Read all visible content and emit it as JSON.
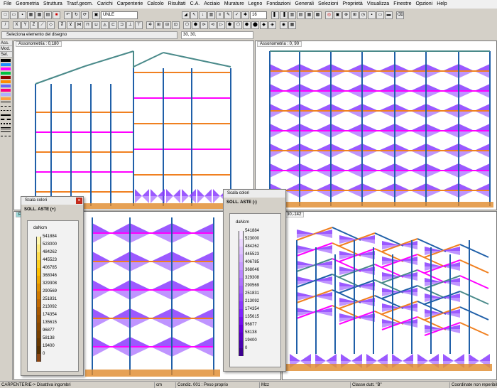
{
  "menu": [
    "File",
    "Geometria",
    "Struttura",
    "Trasf.geom.",
    "Carichi",
    "Carpenterie",
    "Calcolo",
    "Risultati",
    "C.A.",
    "Acciaio",
    "Murature",
    "Legno",
    "Fondazioni",
    "Generali",
    "Selezioni",
    "Proprietà",
    "Visualizza",
    "Finestre",
    "Opzioni",
    "Help"
  ],
  "toolbar1": {
    "combo_value": "16",
    "unle_text": "UNLE"
  },
  "status": {
    "message": "Seleziona  elemento del disegno",
    "coords": "30, 30,"
  },
  "left_panel": {
    "tabs": [
      "Ass.",
      "Mod.",
      "Sel."
    ],
    "swatch_colors": [
      "#000000",
      "#1e90ff",
      "#ff00ff",
      "#00c040",
      "#8b0000",
      "#ff8c00",
      "#6464ff",
      "#ff0080",
      "#b0b0ff",
      "#ffa040"
    ]
  },
  "viewports": [
    {
      "label": "Assonometria :  0,180"
    },
    {
      "label": "Assonometria :  0, 90"
    },
    {
      "label": "Pia"
    },
    {
      "label": "30,-142"
    }
  ],
  "palette_pos": {
    "title": "Scala colori",
    "header": "SOLL. ASTE (+)",
    "unit": "daNcm",
    "values": [
      "541884",
      "523000",
      "484262",
      "445523",
      "406785",
      "368046",
      "329308",
      "290569",
      "251831",
      "213092",
      "174354",
      "135615",
      "96877",
      "58138",
      "19400",
      "0"
    ],
    "colors": [
      "#fff7b0",
      "#ffec80",
      "#ffdd50",
      "#ffd020",
      "#ffc000",
      "#f0a800",
      "#e09000",
      "#d07a00",
      "#c06800",
      "#a85800",
      "#985000",
      "#884800",
      "#784000",
      "#683800",
      "#583000",
      "#8b4513"
    ]
  },
  "palette_neg": {
    "title": "Scala colori",
    "header": "SOLL. ASTE (-)",
    "unit": "daNcm",
    "values": [
      "541884",
      "523000",
      "484262",
      "445523",
      "406785",
      "368046",
      "329308",
      "290569",
      "251831",
      "213092",
      "174354",
      "135615",
      "96877",
      "58138",
      "19400",
      "0"
    ],
    "colors": [
      "#f6ecff",
      "#ecd8ff",
      "#e0c4ff",
      "#d4b0ff",
      "#c89cff",
      "#bc88ff",
      "#b074ff",
      "#a460ff",
      "#984cff",
      "#8c38ff",
      "#8024ff",
      "#7410f0",
      "#6600e0",
      "#5800c8",
      "#4800b0",
      "#3c0090"
    ]
  },
  "bottom": {
    "mode": "CARPENTERIE-> Disattiva ingombri",
    "unit": "cm",
    "condition": "Condiz. 001 : Peso proprio",
    "mzz": "Mzz",
    "ductility": "Classe dutt. \"B\"",
    "coords": "Coordinate non reperibili"
  },
  "colors": {
    "column": "#1f5fa8",
    "beam_orange": "#f08020",
    "beam_magenta": "#ff00ff",
    "beam_teal": "#4a8a8a",
    "diagram_violet": "#8a3cff",
    "diagram_orange": "#e08a2a"
  }
}
